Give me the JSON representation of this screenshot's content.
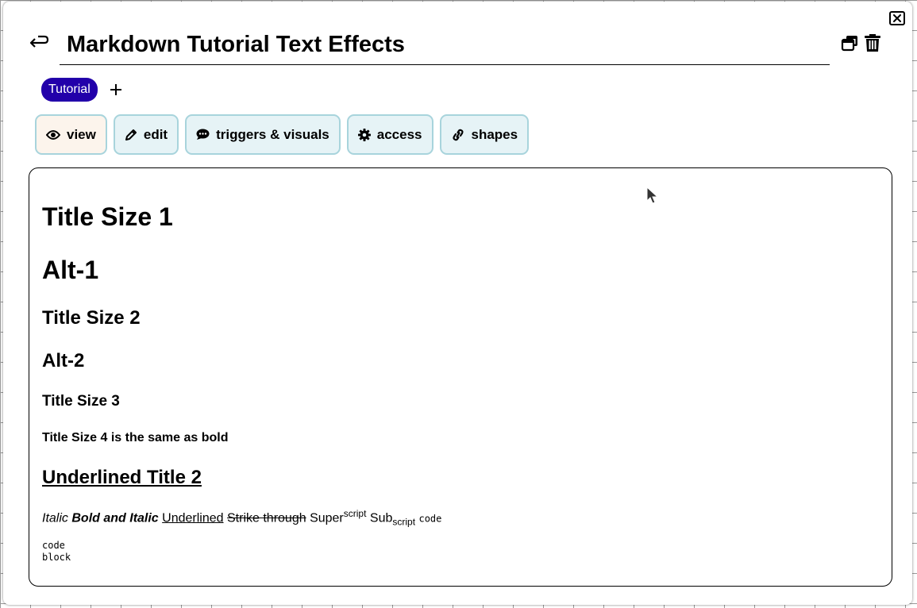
{
  "header": {
    "title": "Markdown Tutorial Text Effects"
  },
  "tags": [
    {
      "label": "Tutorial"
    }
  ],
  "tabs": [
    {
      "label": "view",
      "icon": "eye-icon",
      "active": true
    },
    {
      "label": "edit",
      "icon": "pencil-icon",
      "active": false
    },
    {
      "label": "triggers & visuals",
      "icon": "comment-icon",
      "active": false
    },
    {
      "label": "access",
      "icon": "gear-icon",
      "active": false
    },
    {
      "label": "shapes",
      "icon": "link-icon",
      "active": false
    }
  ],
  "content": {
    "h1_a": "Title Size 1",
    "h1_b": "Alt-1",
    "h2_a": "Title Size 2",
    "h2_b": "Alt-2",
    "h3": "Title Size 3",
    "h4": "Title Size 4 is the same as bold",
    "h2_underlined": "Underlined Title 2",
    "inline": {
      "italic": "Italic",
      "bold_italic": "Bold and Italic",
      "underlined": "Underlined",
      "strike": "Strike through",
      "super_base": "Super",
      "super_text": "script",
      "sub_base": "Sub",
      "sub_text": "script",
      "code": "code"
    },
    "code_block": "code\nblock"
  },
  "colors": {
    "tag_bg": "#2200aa",
    "tab_bg": "#e6f3f6",
    "tab_border": "#a8d4dc",
    "tab_active_bg": "#fcf4ec"
  }
}
